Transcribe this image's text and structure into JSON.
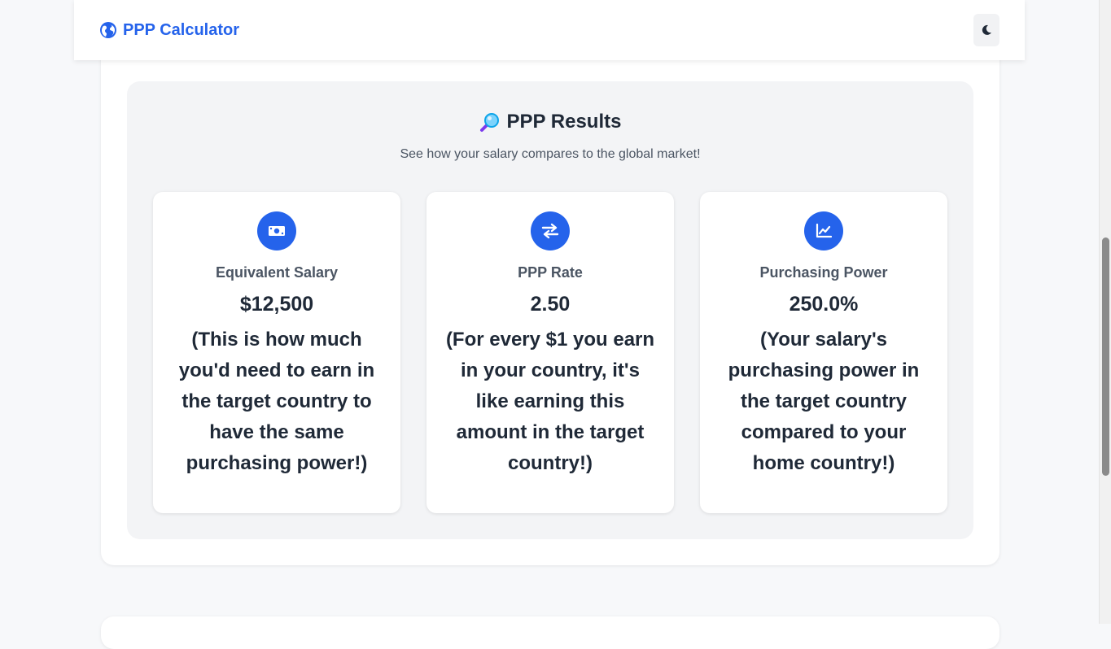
{
  "navbar": {
    "brand": "PPP Calculator",
    "brand_icon": "globe-icon",
    "theme_toggle_icon": "moon-icon"
  },
  "results": {
    "title": "PPP Results",
    "title_icon": "magnifying-glass-icon",
    "subtitle": "See how your salary compares to the global market!",
    "cards": [
      {
        "icon": "money-bill-icon",
        "label": "Equivalent Salary",
        "value": "$12,500",
        "description": "(This is how much you'd need to earn in the target country to have the same purchasing power!)"
      },
      {
        "icon": "exchange-arrows-icon",
        "label": "PPP Rate",
        "value": "2.50",
        "description": "(For every $1 you earn in your country, it's like earning this amount in the target country!)"
      },
      {
        "icon": "chart-line-icon",
        "label": "Purchasing Power",
        "value": "250.0%",
        "description": "(Your salary's purchasing power in the target country compared to your home country!)"
      }
    ]
  },
  "colors": {
    "accent": "#2563eb",
    "panel_bg": "#f3f4f6",
    "text_dark": "#1f2937",
    "text_muted": "#4b5563"
  }
}
